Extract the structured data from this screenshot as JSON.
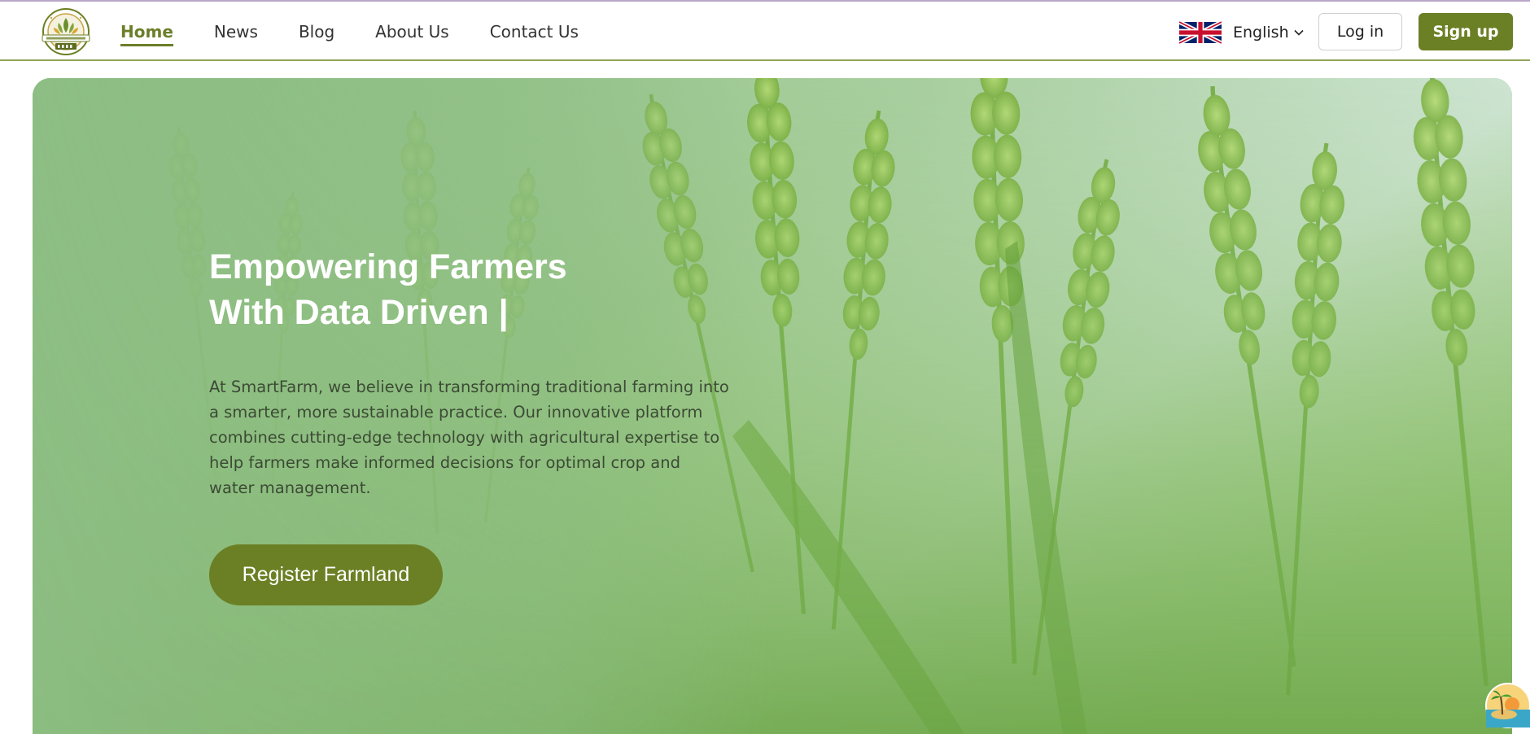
{
  "nav": {
    "logo_text": "FARMS AND SMART FARMS",
    "links": [
      {
        "label": "Home",
        "active": true
      },
      {
        "label": "News",
        "active": false
      },
      {
        "label": "Blog",
        "active": false
      },
      {
        "label": "About Us",
        "active": false
      },
      {
        "label": "Contact Us",
        "active": false
      }
    ],
    "language": {
      "flag_icon": "uk-flag-icon",
      "label": "English"
    },
    "login_label": "Log in",
    "signup_label": "Sign up"
  },
  "hero": {
    "title_line1": "Empowering Farmers",
    "title_line2": "With Data Driven |",
    "description": "At SmartFarm, we believe in transforming traditional farming into a smarter, more sustainable practice. Our innovative platform combines cutting-edge technology with agricultural expertise to help farmers make informed decisions for optimal crop and water management.",
    "cta_label": "Register Farmland",
    "background_icon": "wheat-field-image"
  },
  "floating_badge": {
    "icon": "island-sunset-icon"
  },
  "colors": {
    "accent": "#6b7f24",
    "nav_border": "#93a35a",
    "hero_green": "#8fbf78"
  }
}
